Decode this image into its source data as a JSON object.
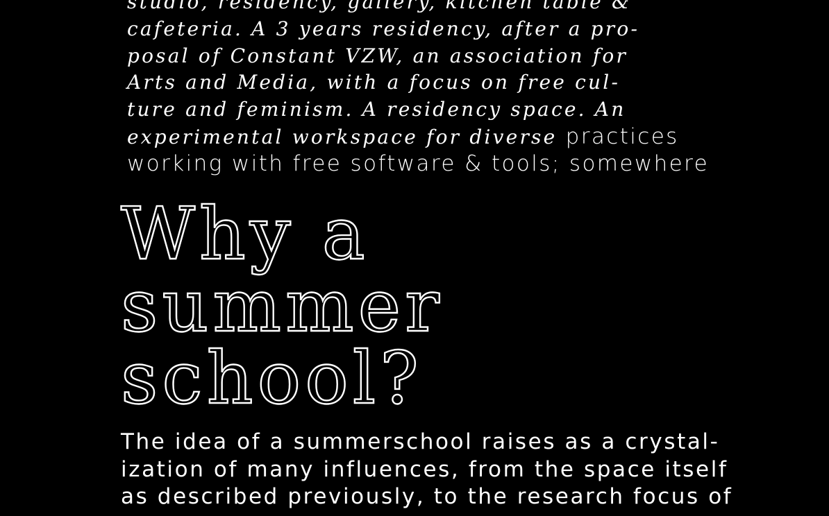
{
  "colors": {
    "background": "#000000",
    "text": "#ffffff"
  },
  "intro": {
    "lines": [
      "studio, residency, gallery, kitchen table &",
      "cafeteria. A 3 years residency, after a pro-",
      "posal of Constant VZW, an association for",
      "Arts and Media, with a focus on free cul-",
      "ture and feminism. A residency space. An"
    ],
    "last_line_script": "experimental workspace for diverse",
    "last_line_sans": " practices",
    "final_line": "working with free software & tools; somewhere"
  },
  "heading": {
    "lines": [
      "Why a",
      "summer",
      "school?"
    ]
  },
  "body": {
    "lines": [
      "The idea of a summerschool raises as a crystal-",
      "ization of many influences, from the space itself",
      "as described previously, to the research focus of"
    ]
  }
}
